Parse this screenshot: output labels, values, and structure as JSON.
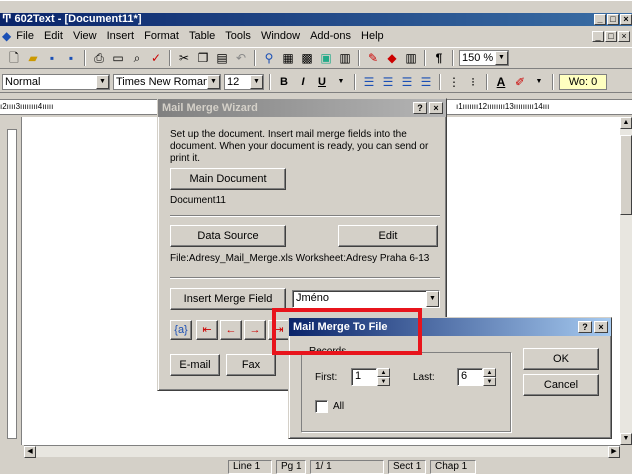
{
  "app": {
    "title": "602Text - [Document11*]",
    "caption_buttons": [
      "_",
      "□",
      "×"
    ]
  },
  "menu": [
    "File",
    "Edit",
    "View",
    "Insert",
    "Format",
    "Table",
    "Tools",
    "Window",
    "Add-ons",
    "Help"
  ],
  "toolbar": {
    "zoom": "150 %",
    "paragraph_mark": "¶"
  },
  "format_bar": {
    "style": "Normal",
    "font": "Times New Roman (Stř",
    "size": "12",
    "bold": "B",
    "italic": "I",
    "underline": "U",
    "wo": "Wo: 0"
  },
  "ruler": {
    "text": "ı2ıııı3ıııııııı4ııııı",
    "right_text": "ı1ııııııı12ıııııııı13ııııııııı14ııı"
  },
  "status": {
    "line": "Line  1",
    "page": "Pg  1",
    "of": "1/  1",
    "sect": "Sect 1",
    "chap": "Chap  1"
  },
  "wizard": {
    "title": "Mail Merge Wizard",
    "help": "?",
    "close": "×",
    "instructions": "Set up the document. Insert mail merge fields into the document. When your document is ready, you can send or print it.",
    "main_document_button": "Main Document",
    "main_document_name": "Document11",
    "data_source_button": "Data Source",
    "edit_button": "Edit",
    "data_source_file": "File:Adresy_Mail_Merge.xls Worksheet:Adresy Praha 6-13",
    "insert_merge_field_button": "Insert Merge Field",
    "merge_field_value": "Jméno",
    "field_code_button": "{a}",
    "email_button": "E-mail",
    "fax_button": "Fax"
  },
  "merge_to_file": {
    "title": "Mail Merge To File",
    "help": "?",
    "close": "×",
    "records_label": "Records",
    "first_label": "First:",
    "first_value": "1",
    "last_label": "Last:",
    "last_value": "6",
    "all_label": "All",
    "ok_button": "OK",
    "cancel_button": "Cancel"
  },
  "colors": {
    "highlight": "#e8141c",
    "active_title": "#0a246a",
    "face": "#d4d0c8"
  }
}
